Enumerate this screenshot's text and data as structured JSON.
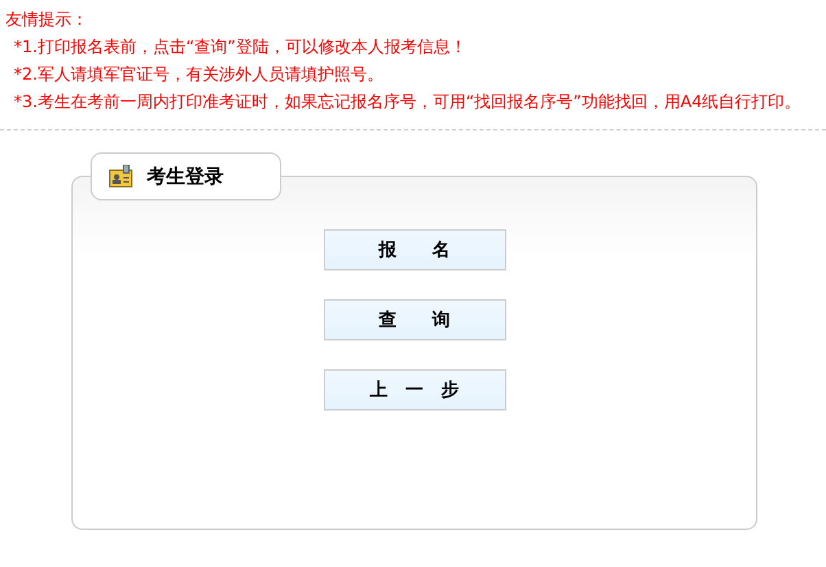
{
  "notice": {
    "title": "友情提示：",
    "items": [
      "*1.打印报名表前，点击“查询”登陆，可以修改本人报考信息！",
      "*2.军人请填军官证号，有关涉外人员请填护照号。",
      "*3.考生在考前一周内打印准考证时，如果忘记报名序号，可用“找回报名序号”功能找回，用A4纸自行打印。"
    ]
  },
  "login": {
    "title": "考生登录",
    "buttons": [
      "报　　名",
      "查　　询",
      "上　一　步"
    ]
  }
}
